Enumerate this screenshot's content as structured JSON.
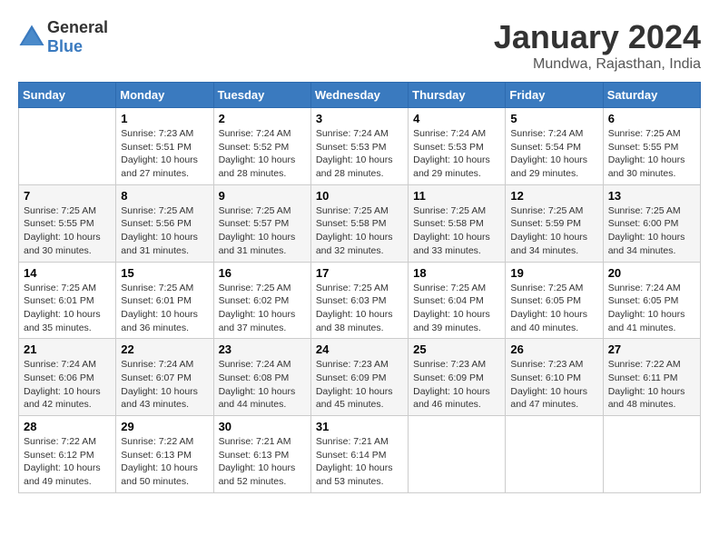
{
  "header": {
    "logo_general": "General",
    "logo_blue": "Blue",
    "month_year": "January 2024",
    "location": "Mundwa, Rajasthan, India"
  },
  "days_of_week": [
    "Sunday",
    "Monday",
    "Tuesday",
    "Wednesday",
    "Thursday",
    "Friday",
    "Saturday"
  ],
  "weeks": [
    [
      {
        "day": "",
        "info": ""
      },
      {
        "day": "1",
        "info": "Sunrise: 7:23 AM\nSunset: 5:51 PM\nDaylight: 10 hours\nand 27 minutes."
      },
      {
        "day": "2",
        "info": "Sunrise: 7:24 AM\nSunset: 5:52 PM\nDaylight: 10 hours\nand 28 minutes."
      },
      {
        "day": "3",
        "info": "Sunrise: 7:24 AM\nSunset: 5:53 PM\nDaylight: 10 hours\nand 28 minutes."
      },
      {
        "day": "4",
        "info": "Sunrise: 7:24 AM\nSunset: 5:53 PM\nDaylight: 10 hours\nand 29 minutes."
      },
      {
        "day": "5",
        "info": "Sunrise: 7:24 AM\nSunset: 5:54 PM\nDaylight: 10 hours\nand 29 minutes."
      },
      {
        "day": "6",
        "info": "Sunrise: 7:25 AM\nSunset: 5:55 PM\nDaylight: 10 hours\nand 30 minutes."
      }
    ],
    [
      {
        "day": "7",
        "info": "Sunrise: 7:25 AM\nSunset: 5:55 PM\nDaylight: 10 hours\nand 30 minutes."
      },
      {
        "day": "8",
        "info": "Sunrise: 7:25 AM\nSunset: 5:56 PM\nDaylight: 10 hours\nand 31 minutes."
      },
      {
        "day": "9",
        "info": "Sunrise: 7:25 AM\nSunset: 5:57 PM\nDaylight: 10 hours\nand 31 minutes."
      },
      {
        "day": "10",
        "info": "Sunrise: 7:25 AM\nSunset: 5:58 PM\nDaylight: 10 hours\nand 32 minutes."
      },
      {
        "day": "11",
        "info": "Sunrise: 7:25 AM\nSunset: 5:58 PM\nDaylight: 10 hours\nand 33 minutes."
      },
      {
        "day": "12",
        "info": "Sunrise: 7:25 AM\nSunset: 5:59 PM\nDaylight: 10 hours\nand 34 minutes."
      },
      {
        "day": "13",
        "info": "Sunrise: 7:25 AM\nSunset: 6:00 PM\nDaylight: 10 hours\nand 34 minutes."
      }
    ],
    [
      {
        "day": "14",
        "info": "Sunrise: 7:25 AM\nSunset: 6:01 PM\nDaylight: 10 hours\nand 35 minutes."
      },
      {
        "day": "15",
        "info": "Sunrise: 7:25 AM\nSunset: 6:01 PM\nDaylight: 10 hours\nand 36 minutes."
      },
      {
        "day": "16",
        "info": "Sunrise: 7:25 AM\nSunset: 6:02 PM\nDaylight: 10 hours\nand 37 minutes."
      },
      {
        "day": "17",
        "info": "Sunrise: 7:25 AM\nSunset: 6:03 PM\nDaylight: 10 hours\nand 38 minutes."
      },
      {
        "day": "18",
        "info": "Sunrise: 7:25 AM\nSunset: 6:04 PM\nDaylight: 10 hours\nand 39 minutes."
      },
      {
        "day": "19",
        "info": "Sunrise: 7:25 AM\nSunset: 6:05 PM\nDaylight: 10 hours\nand 40 minutes."
      },
      {
        "day": "20",
        "info": "Sunrise: 7:24 AM\nSunset: 6:05 PM\nDaylight: 10 hours\nand 41 minutes."
      }
    ],
    [
      {
        "day": "21",
        "info": "Sunrise: 7:24 AM\nSunset: 6:06 PM\nDaylight: 10 hours\nand 42 minutes."
      },
      {
        "day": "22",
        "info": "Sunrise: 7:24 AM\nSunset: 6:07 PM\nDaylight: 10 hours\nand 43 minutes."
      },
      {
        "day": "23",
        "info": "Sunrise: 7:24 AM\nSunset: 6:08 PM\nDaylight: 10 hours\nand 44 minutes."
      },
      {
        "day": "24",
        "info": "Sunrise: 7:23 AM\nSunset: 6:09 PM\nDaylight: 10 hours\nand 45 minutes."
      },
      {
        "day": "25",
        "info": "Sunrise: 7:23 AM\nSunset: 6:09 PM\nDaylight: 10 hours\nand 46 minutes."
      },
      {
        "day": "26",
        "info": "Sunrise: 7:23 AM\nSunset: 6:10 PM\nDaylight: 10 hours\nand 47 minutes."
      },
      {
        "day": "27",
        "info": "Sunrise: 7:22 AM\nSunset: 6:11 PM\nDaylight: 10 hours\nand 48 minutes."
      }
    ],
    [
      {
        "day": "28",
        "info": "Sunrise: 7:22 AM\nSunset: 6:12 PM\nDaylight: 10 hours\nand 49 minutes."
      },
      {
        "day": "29",
        "info": "Sunrise: 7:22 AM\nSunset: 6:13 PM\nDaylight: 10 hours\nand 50 minutes."
      },
      {
        "day": "30",
        "info": "Sunrise: 7:21 AM\nSunset: 6:13 PM\nDaylight: 10 hours\nand 52 minutes."
      },
      {
        "day": "31",
        "info": "Sunrise: 7:21 AM\nSunset: 6:14 PM\nDaylight: 10 hours\nand 53 minutes."
      },
      {
        "day": "",
        "info": ""
      },
      {
        "day": "",
        "info": ""
      },
      {
        "day": "",
        "info": ""
      }
    ]
  ]
}
